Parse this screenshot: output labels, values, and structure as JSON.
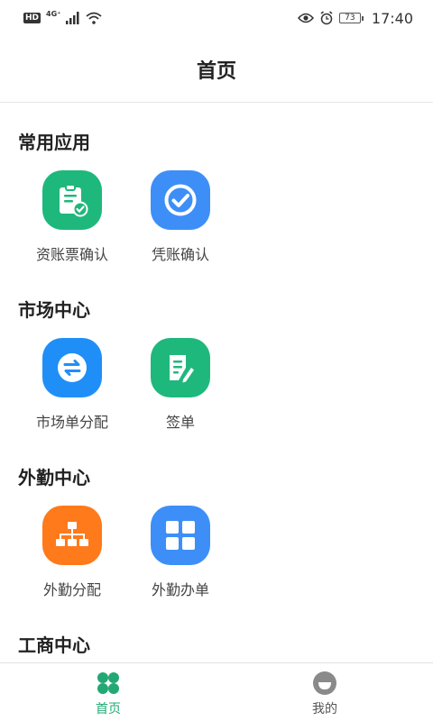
{
  "status_bar": {
    "hd": "HD",
    "network": "4G⁺",
    "battery": "73",
    "time": "17:40"
  },
  "header": {
    "title": "首页"
  },
  "sections": [
    {
      "title": "常用应用",
      "items": [
        {
          "label": "资账票确认",
          "icon": "clipboard-check-icon",
          "color": "#1fb87c"
        },
        {
          "label": "凭账确认",
          "icon": "check-circle-icon",
          "color": "#3d8ff7"
        }
      ]
    },
    {
      "title": "市场中心",
      "items": [
        {
          "label": "市场单分配",
          "icon": "exchange-arrows-icon",
          "color": "#1f8ff7"
        },
        {
          "label": "签单",
          "icon": "document-edit-icon",
          "color": "#1fb87c"
        }
      ]
    },
    {
      "title": "外勤中心",
      "items": [
        {
          "label": "外勤分配",
          "icon": "org-chart-icon",
          "color": "#ff7a1a"
        },
        {
          "label": "外勤办单",
          "icon": "grid-apps-icon",
          "color": "#3d8ff7"
        }
      ]
    },
    {
      "title": "工商中心",
      "items": []
    }
  ],
  "bottom_nav": {
    "items": [
      {
        "label": "首页",
        "icon": "clover-home-icon",
        "active": true,
        "color": "#22a873"
      },
      {
        "label": "我的",
        "icon": "smiley-profile-icon",
        "active": false,
        "color": "#555555"
      }
    ]
  }
}
